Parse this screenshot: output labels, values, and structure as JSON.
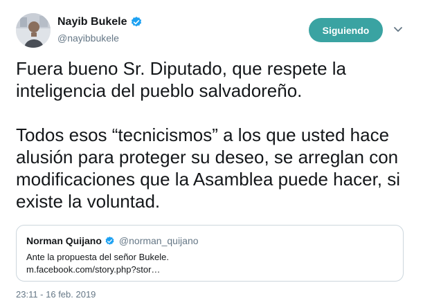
{
  "author": {
    "name": "Nayib Bukele",
    "handle": "@nayibbukele",
    "verified": true
  },
  "follow_button": {
    "label": "Siguiendo",
    "color": "#3aa3a2"
  },
  "menu": {
    "icon": "chevron-down-icon"
  },
  "tweet": {
    "paragraph_1": "Fuera bueno Sr. Diputado, que respete la inteligencia del pueblo salvadoreño.",
    "paragraph_2": "Todos esos “tecnicismos” a los que usted hace alusión para proteger su deseo, se arreglan con modificaciones que la Asamblea puede hacer, si existe la voluntad."
  },
  "quoted_tweet": {
    "name": "Norman Quijano",
    "handle": "@norman_quijano",
    "verified": true,
    "line_1": "Ante la propuesta del señor Bukele.",
    "line_2": "m.facebook.com/story.php?stor…"
  },
  "timestamp": "23:11 - 16 feb. 2019",
  "colors": {
    "verified_blue": "#1da1f2",
    "secondary_text": "#657786",
    "border": "#ccd6dd"
  }
}
